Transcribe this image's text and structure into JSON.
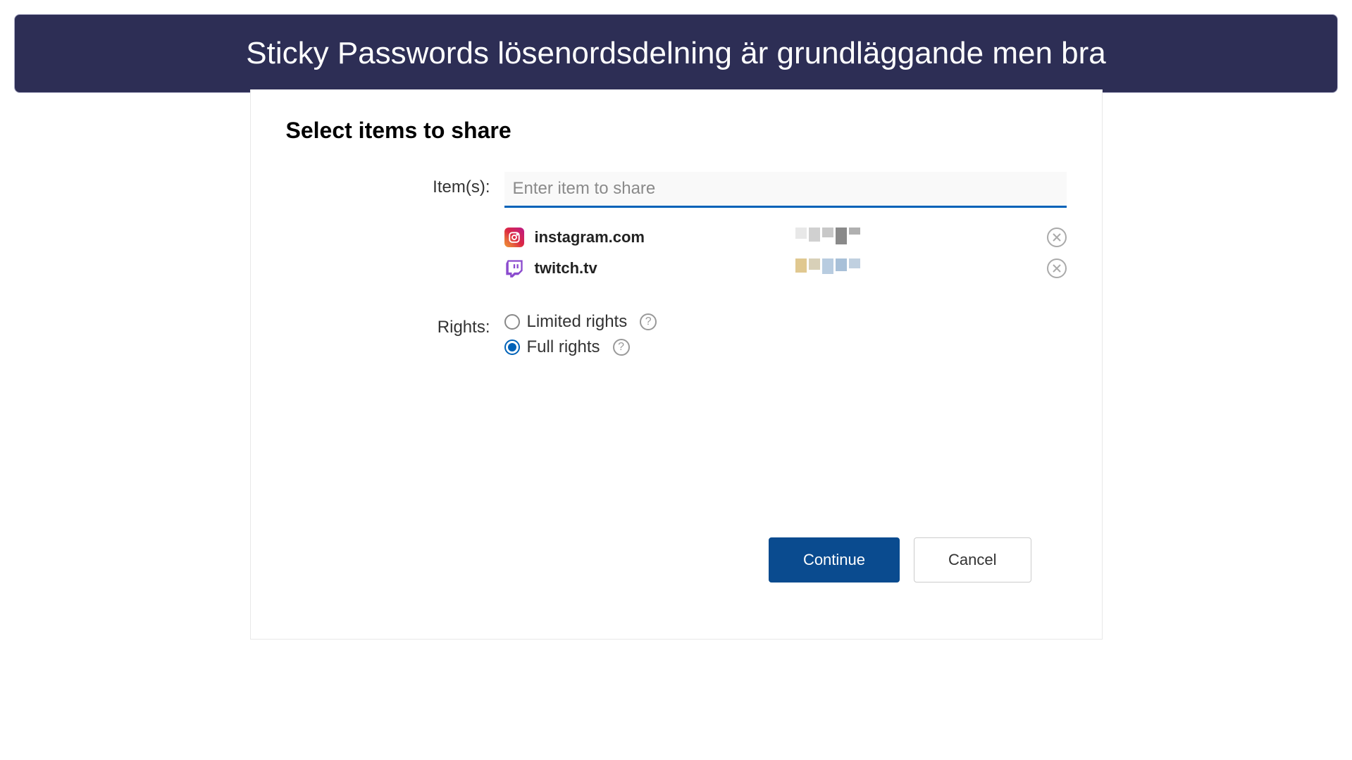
{
  "banner": {
    "title": "Sticky Passwords lösenordsdelning är grundläggande men bra"
  },
  "dialog": {
    "title": "Select items to share",
    "items_label": "Item(s):",
    "input_placeholder": "Enter item to share",
    "items": [
      {
        "name": "instagram.com",
        "icon": "instagram"
      },
      {
        "name": "twitch.tv",
        "icon": "twitch"
      }
    ],
    "rights_label": "Rights:",
    "rights_options": {
      "limited": "Limited rights",
      "full": "Full rights",
      "selected": "full"
    },
    "buttons": {
      "continue": "Continue",
      "cancel": "Cancel"
    }
  }
}
